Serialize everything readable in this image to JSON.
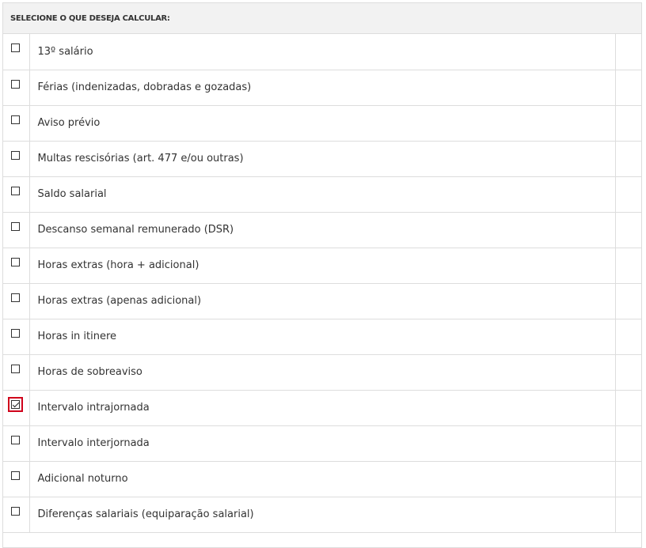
{
  "header": {
    "title": "SELECIONE O QUE DESEJA CALCULAR:"
  },
  "options": [
    {
      "label": "13º salário",
      "checked": false
    },
    {
      "label": "Férias (indenizadas, dobradas e gozadas)",
      "checked": false
    },
    {
      "label": "Aviso prévio",
      "checked": false
    },
    {
      "label": "Multas rescisórias (art. 477 e/ou outras)",
      "checked": false
    },
    {
      "label": "Saldo salarial",
      "checked": false
    },
    {
      "label": "Descanso semanal remunerado (DSR)",
      "checked": false
    },
    {
      "label": "Horas extras (hora + adicional)",
      "checked": false
    },
    {
      "label": "Horas extras (apenas adicional)",
      "checked": false
    },
    {
      "label": "Horas in itinere",
      "checked": false
    },
    {
      "label": "Horas de sobreaviso",
      "checked": false
    },
    {
      "label": "Intervalo intrajornada",
      "checked": true
    },
    {
      "label": "Intervalo interjornada",
      "checked": false
    },
    {
      "label": "Adicional noturno",
      "checked": false
    },
    {
      "label": "Diferenças salariais (equiparação salarial)",
      "checked": false
    }
  ],
  "colors": {
    "highlight": "#d0021b",
    "border": "#dddddd",
    "header_bg": "#f2f2f2"
  }
}
